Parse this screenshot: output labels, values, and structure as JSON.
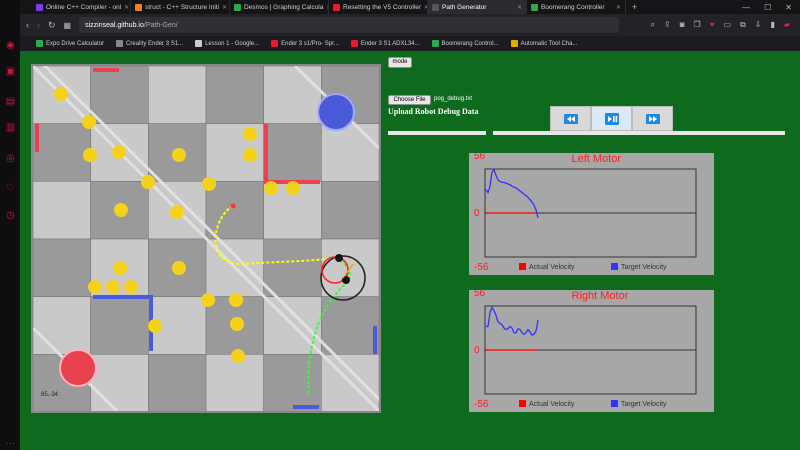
{
  "browser": {
    "tabs": [
      {
        "label": "Online C++ Compiler - onl",
        "color": "#7c3aed"
      },
      {
        "label": "struct - C++ Structure Initi",
        "color": "#f48024"
      },
      {
        "label": "Desmos | Graphing Calcula",
        "color": "#2fa84f"
      },
      {
        "label": "Resetting the V5 Controller",
        "color": "#e11d2e"
      },
      {
        "label": "Path Generator",
        "color": "#555555"
      },
      {
        "label": "Boomerang Controller",
        "color": "#2fa84f"
      }
    ],
    "url_host": "sizzinseal.github.io",
    "url_path": "/Path-Gen/",
    "bookmarks": [
      {
        "label": "Expo Drive Calculator",
        "color": "#2fa84f"
      },
      {
        "label": "Creality Ender 3 S1...",
        "color": "#888888"
      },
      {
        "label": "Lesson 1 - Google...",
        "color": "#cccccc"
      },
      {
        "label": "Ender 3 s1/Pro- Spr...",
        "color": "#e11d2e"
      },
      {
        "label": "Ender 3 S1 ADXL34...",
        "color": "#e11d2e"
      },
      {
        "label": "Boomerang Control...",
        "color": "#2fa84f"
      },
      {
        "label": "Automatic Tool Cha...",
        "color": "#e0b000"
      }
    ]
  },
  "app": {
    "mode_button": "mode",
    "choose_file_button": "Choose File",
    "file_name": "pog_debug.txt",
    "upload_label": "Upload Robot Debug Data",
    "player_progress": 0.0,
    "field_coord": "85,-34"
  },
  "colors": {
    "page_bg": "#0e6a1c",
    "chart_bg": "#a7a7a7",
    "actual": "#ff0000",
    "target": "#3333ff",
    "triball": "#f5d21a",
    "red_alliance": "#e8414f",
    "blue_alliance": "#4b5bd8"
  },
  "chart_data": [
    {
      "type": "line",
      "title": "Left Motor",
      "ylim": [
        -56,
        56
      ],
      "y_ticks": [
        "56",
        "0",
        "-56"
      ],
      "legend": [
        "Actual Velocity",
        "Target Velocity"
      ],
      "x": [
        0,
        2,
        4,
        6,
        8,
        10,
        12,
        14,
        16,
        18,
        20,
        22,
        24,
        26,
        28,
        30,
        32,
        34,
        36,
        38,
        40,
        42,
        44,
        46,
        48,
        50,
        52
      ],
      "series": [
        {
          "name": "Actual Velocity",
          "values": [
            0,
            0,
            0,
            0,
            0,
            0,
            0,
            0,
            0,
            0,
            0,
            0,
            0,
            0,
            0,
            0,
            0,
            0,
            0,
            0,
            0,
            0,
            0,
            0,
            0,
            0,
            0
          ]
        },
        {
          "name": "Target Velocity",
          "values": [
            30,
            26,
            34,
            52,
            55,
            48,
            42,
            40,
            39,
            39,
            38,
            37,
            36,
            34,
            33,
            32,
            30,
            28,
            26,
            24,
            22,
            20,
            17,
            14,
            10,
            4,
            -6
          ]
        }
      ]
    },
    {
      "type": "line",
      "title": "Right Motor",
      "ylim": [
        -56,
        56
      ],
      "y_ticks": [
        "56",
        "0",
        "-56"
      ],
      "legend": [
        "Actual Velocity",
        "Target Velocity"
      ],
      "x": [
        0,
        2,
        4,
        6,
        8,
        10,
        12,
        14,
        16,
        18,
        20,
        22,
        24,
        26,
        28,
        30,
        32,
        34,
        36,
        38,
        40,
        42,
        44,
        46,
        48,
        50,
        52
      ],
      "series": [
        {
          "name": "Actual Velocity",
          "values": [
            0,
            0,
            0,
            0,
            0,
            0,
            0,
            0,
            0,
            0,
            0,
            0,
            0,
            0,
            0,
            0,
            0,
            0,
            0,
            0,
            0,
            0,
            0,
            0,
            0,
            0,
            0
          ]
        },
        {
          "name": "Target Velocity",
          "values": [
            30,
            30,
            48,
            54,
            50,
            44,
            36,
            34,
            32,
            28,
            26,
            27,
            30,
            28,
            22,
            22,
            27,
            26,
            22,
            20,
            22,
            26,
            23,
            19,
            20,
            24,
            38
          ]
        }
      ]
    }
  ]
}
